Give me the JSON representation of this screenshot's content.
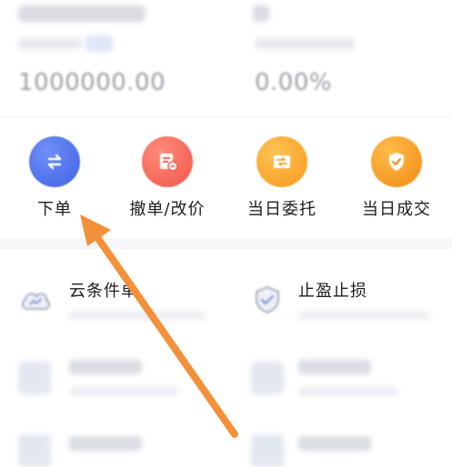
{
  "summary": {
    "left_value": "1000000.00",
    "right_value": "0.00%"
  },
  "actions": [
    {
      "label": "下单",
      "icon": "transfer-icon",
      "color": "#4a6cea"
    },
    {
      "label": "撤单/改价",
      "icon": "cancel-order-icon",
      "color": "#f25a4d"
    },
    {
      "label": "当日委托",
      "icon": "entrust-icon",
      "color": "#f7a124"
    },
    {
      "label": "当日成交",
      "icon": "deal-shield-icon",
      "color": "#f4921a"
    }
  ],
  "list": {
    "cloud": {
      "title": "云条件单",
      "icon": "cloud-icon"
    },
    "stop": {
      "title": "止盈止损",
      "icon": "shield-check-icon"
    }
  },
  "annotation": {
    "color": "#f2913a",
    "icon": "pointer-arrow-icon"
  }
}
